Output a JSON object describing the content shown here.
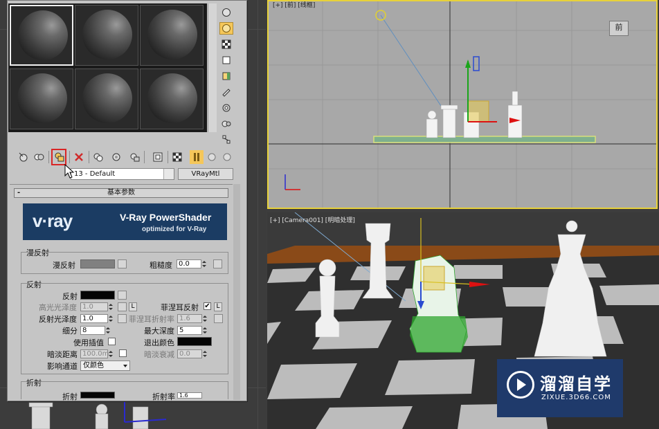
{
  "material_editor": {
    "toolbar": {
      "buttons": [
        "get-material",
        "put-to-scene",
        "assign-to-selection",
        "reset",
        "make-copy",
        "make-unique",
        "put-to-library",
        "material-id",
        "show-in-viewport",
        "show-end-result",
        "go-to-parent",
        "go-forward"
      ]
    },
    "material_name": "13 - Default",
    "material_type": "VRayMtl",
    "rollout_title": "基本参数",
    "rollout_toggle": "-",
    "banner": {
      "logo": "v·ray",
      "title": "V-Ray PowerShader",
      "subtitle": "optimized for V-Ray"
    },
    "diffuse": {
      "group": "漫反射",
      "diffuse_label": "漫反射",
      "diffuse_color": "#808080",
      "roughness_label": "粗糙度",
      "roughness_value": "0.0"
    },
    "reflection": {
      "group": "反射",
      "reflect_label": "反射",
      "reflect_color": "#050505",
      "hilight_gloss_label": "高光光泽度",
      "hilight_gloss_value": "1.0",
      "L": "L",
      "fresnel_label": "菲涅耳反射",
      "fresnel_checked": "✔",
      "refl_gloss_label": "反射光泽度",
      "refl_gloss_value": "1.0",
      "fresnel_ior_label": "菲涅耳折射率",
      "fresnel_ior_value": "1.6",
      "subdivs_label": "细分",
      "subdivs_value": "8",
      "max_depth_label": "最大深度",
      "max_depth_value": "5",
      "use_interp_label": "使用插值",
      "exit_color_label": "退出颜色",
      "exit_color": "#050505",
      "dim_distance_label": "暗淡距离",
      "dim_distance_value": "100.0m",
      "dim_falloff_label": "暗淡衰减",
      "dim_falloff_value": "0.0",
      "affect_channels_label": "影响通道",
      "affect_channels_value": "仅颜色"
    },
    "refraction": {
      "group": "折射",
      "refract_label": "折射",
      "ior_label": "折射率",
      "ior_value": "1.6"
    }
  },
  "viewports": {
    "top_label": "[+] [前] [线框]",
    "cam_label": "[+] [Camera001] [明暗处理]",
    "viewcube_face": "前"
  },
  "watermark": {
    "brand": "溜溜自学",
    "url": "ZIXUE.3D66.COM"
  }
}
